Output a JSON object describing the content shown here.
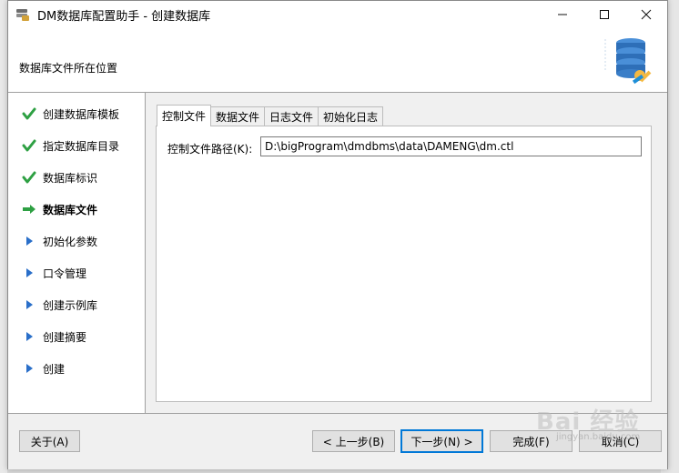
{
  "window": {
    "title": "DM数据库配置助手 - 创建数据库"
  },
  "window_controls": {
    "minimize": "—",
    "maximize": "☐",
    "close": "✕"
  },
  "header": {
    "text": "数据库文件所在位置"
  },
  "steps": [
    {
      "label": "创建数据库模板",
      "status": "done"
    },
    {
      "label": "指定数据库目录",
      "status": "done"
    },
    {
      "label": "数据库标识",
      "status": "done"
    },
    {
      "label": "数据库文件",
      "status": "current"
    },
    {
      "label": "初始化参数",
      "status": "pending"
    },
    {
      "label": "口令管理",
      "status": "pending"
    },
    {
      "label": "创建示例库",
      "status": "pending"
    },
    {
      "label": "创建摘要",
      "status": "pending"
    },
    {
      "label": "创建",
      "status": "pending"
    }
  ],
  "tabs": [
    {
      "label": "控制文件",
      "active": true
    },
    {
      "label": "数据文件",
      "active": false
    },
    {
      "label": "日志文件",
      "active": false
    },
    {
      "label": "初始化日志",
      "active": false
    }
  ],
  "control_file": {
    "label": "控制文件路径(K):",
    "value": "D:\\bigProgram\\dmdbms\\data\\DAMENG\\dm.ctl"
  },
  "buttons": {
    "about": "关于(A)",
    "prev": "< 上一步(B)",
    "next": "下一步(N) >",
    "finish": "完成(F)",
    "cancel": "取消(C)"
  },
  "watermark": {
    "main": "Bai 经验",
    "sub": "jingyan.baidu.com"
  },
  "colors": {
    "check": "#2ea043",
    "current_arrow": "#2ea043",
    "pending_arrow": "#2a6fc9",
    "focus_border": "#0078d7"
  }
}
